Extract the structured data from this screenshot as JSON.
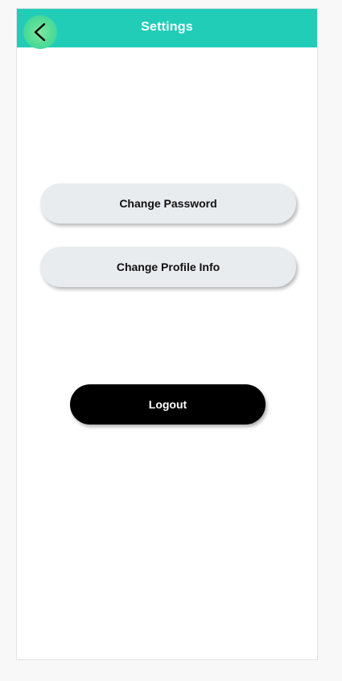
{
  "header": {
    "title": "Settings",
    "back_icon": "chevron-left-icon",
    "bg_color": "#22cdb8"
  },
  "actions": {
    "change_password_label": "Change Password",
    "change_profile_label": "Change Profile Info",
    "logout_label": "Logout"
  }
}
